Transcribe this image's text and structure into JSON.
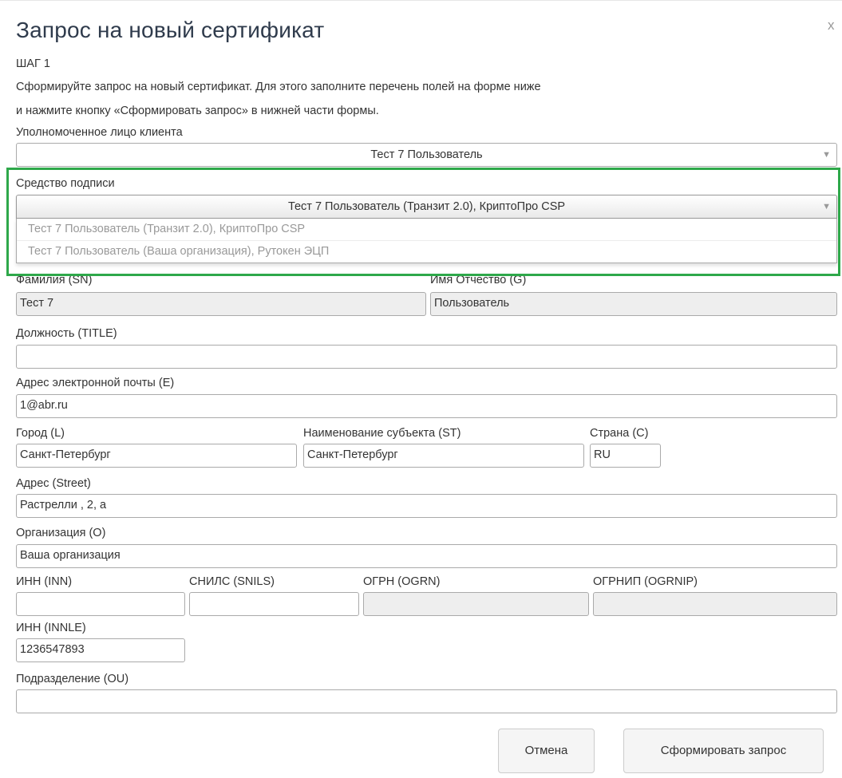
{
  "dialog": {
    "title": "Запрос на новый сертификат",
    "close_glyph": "x",
    "step": "ШАГ 1",
    "instructions_line1": "Сформируйте запрос на новый сертификат. Для этого заполните перечень полей на форме ниже",
    "instructions_line2": "и нажмите кнопку «Сформировать запрос» в нижней части формы."
  },
  "authorized_person": {
    "label": "Уполномоченное лицо клиента",
    "value": "Тест 7 Пользователь"
  },
  "signing_tool": {
    "label": "Средство подписи",
    "value": "Тест 7 Пользователь (Транзит 2.0), КриптоПро CSP",
    "options": [
      "Тест 7 Пользователь (Транзит 2.0), КриптоПро CSP",
      "Тест 7 Пользователь (Ваша организация), Рутокен ЭЦП"
    ],
    "highlight_color": "#2ea84a"
  },
  "fields": {
    "surname": {
      "label": "Фамилия (SN)",
      "value": "Тест 7"
    },
    "given_name": {
      "label": "Имя Отчество (G)",
      "value": "Пользователь"
    },
    "title": {
      "label": "Должность (TITLE)",
      "value": ""
    },
    "email": {
      "label": "Адрес электронной почты (E)",
      "value": "1@abr.ru"
    },
    "city": {
      "label": "Город (L)",
      "value": "Санкт-Петербург"
    },
    "state": {
      "label": "Наименование субъекта (ST)",
      "value": "Санкт-Петербург"
    },
    "country": {
      "label": "Страна (C)",
      "value": "RU"
    },
    "street": {
      "label": "Адрес (Street)",
      "value": "Растрелли , 2, а"
    },
    "organization": {
      "label": "Организация (O)",
      "value": "Ваша организация"
    },
    "inn": {
      "label": "ИНН (INN)",
      "value": ""
    },
    "snils": {
      "label": "СНИЛС (SNILS)",
      "value": ""
    },
    "ogrn": {
      "label": "ОГРН (OGRN)",
      "value": ""
    },
    "ogrnip": {
      "label": "ОГРНИП (OGRNIP)",
      "value": ""
    },
    "innle": {
      "label": "ИНН (INNLE)",
      "value": "1236547893"
    },
    "ou": {
      "label": "Подразделение (OU)",
      "value": ""
    }
  },
  "buttons": {
    "cancel": "Отмена",
    "submit": "Сформировать запрос"
  },
  "icons": {
    "dropdown_arrow": "▼"
  }
}
